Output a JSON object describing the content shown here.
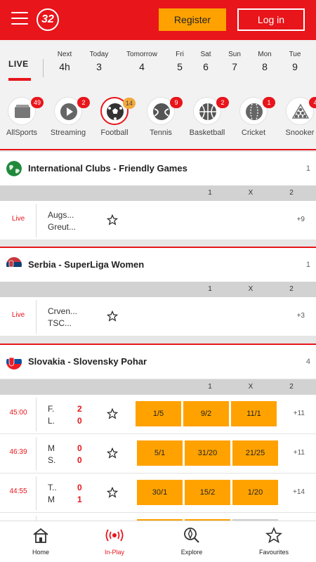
{
  "header": {
    "logo_text": "32",
    "register_label": "Register",
    "login_label": "Log in"
  },
  "datenav": {
    "live_label": "LIVE",
    "days": [
      {
        "top": "Next",
        "bottom": "4h"
      },
      {
        "top": "Today",
        "bottom": "3"
      },
      {
        "top": "Tomorrow",
        "bottom": "4"
      },
      {
        "top": "Fri",
        "bottom": "5"
      },
      {
        "top": "Sat",
        "bottom": "6"
      },
      {
        "top": "Sun",
        "bottom": "7"
      },
      {
        "top": "Mon",
        "bottom": "8"
      },
      {
        "top": "Tue",
        "bottom": "9"
      }
    ]
  },
  "sports": [
    {
      "label": "AllSports",
      "badge": "49",
      "icon": "folder-icon"
    },
    {
      "label": "Streaming",
      "badge": "2",
      "icon": "play-icon"
    },
    {
      "label": "Football",
      "badge": "14",
      "icon": "football-icon"
    },
    {
      "label": "Tennis",
      "badge": "9",
      "icon": "tennis-icon"
    },
    {
      "label": "Basketball",
      "badge": "2",
      "icon": "basketball-icon"
    },
    {
      "label": "Cricket",
      "badge": "1",
      "icon": "cricket-icon"
    },
    {
      "label": "Snooker",
      "badge": "4",
      "icon": "snooker-icon"
    }
  ],
  "columns": {
    "c1": "1",
    "cx": "X",
    "c2": "2"
  },
  "leagues": [
    {
      "name": "International Clubs - Friendly Games",
      "count": "1",
      "matches": [
        {
          "time": "Live",
          "team1": "Augs...",
          "team2": "Greut...",
          "more": "+9"
        }
      ]
    },
    {
      "name": "Serbia - SuperLiga Women",
      "count": "1",
      "matches": [
        {
          "time": "Live",
          "team1": "Crven...",
          "team2": "TSC...",
          "more": "+3"
        }
      ]
    },
    {
      "name": "Slovakia - Slovensky Pohar",
      "count": "4",
      "matches": [
        {
          "time": "45:00",
          "team1": "F.",
          "team2": "L.",
          "score1": "2",
          "score2": "0",
          "odds": [
            "1/5",
            "9/2",
            "11/1"
          ],
          "more": "+11"
        },
        {
          "time": "46:39",
          "team1": "M",
          "team2": "S.",
          "score1": "0",
          "score2": "0",
          "odds": [
            "5/1",
            "31/20",
            "21/25"
          ],
          "more": "+11"
        },
        {
          "time": "44:55",
          "team1": "T..",
          "team2": "M",
          "score1": "0",
          "score2": "1",
          "odds": [
            "30/1",
            "15/2",
            "1/20"
          ],
          "more": "+14"
        }
      ]
    }
  ],
  "bottomnav": [
    {
      "label": "Home",
      "icon": "home-icon"
    },
    {
      "label": "In-Play",
      "icon": "broadcast-icon"
    },
    {
      "label": "Explore",
      "icon": "explore-icon"
    },
    {
      "label": "Favourites",
      "icon": "star-icon"
    }
  ]
}
